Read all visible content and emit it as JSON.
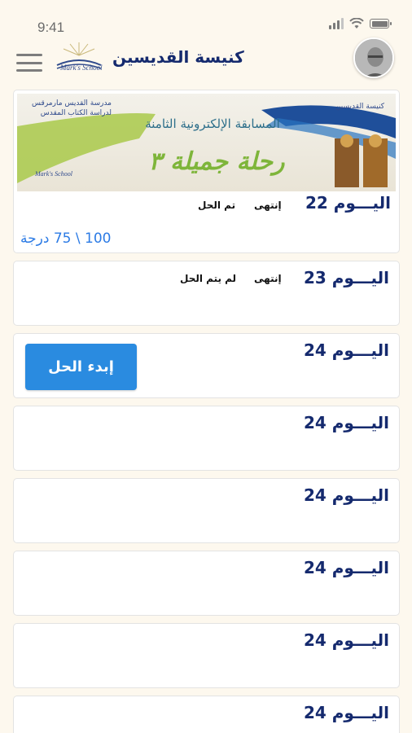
{
  "status_bar": {
    "time": "9:41"
  },
  "header": {
    "title": "كنيسة القديسين",
    "logo_text": "Mark's School",
    "menu_icon": "hamburger-menu-icon",
    "avatar": "user-avatar"
  },
  "banner": {
    "title_line1": "المسابقة الإلكترونية الثامنة",
    "title_line2": "رحلة جميلة ٣",
    "top_left_text": "مدرسة القديس مارمرقس لدراسة الكتاب المقدس",
    "top_right_text": "كنيسة القديسين",
    "logo_text": "Mark's School"
  },
  "days": [
    {
      "label": "اليـــوم 22",
      "status_label": "إنتهى",
      "status_value": "تم الحل",
      "score": "100 \\ 75 درجة"
    },
    {
      "label": "اليـــوم 23",
      "status_label": "إنتهى",
      "status_value": "لم يتم الحل"
    },
    {
      "label": "اليـــوم 24",
      "button": "إبدء الحل"
    },
    {
      "label": "اليـــوم 24"
    },
    {
      "label": "اليـــوم 24"
    },
    {
      "label": "اليـــوم 24"
    },
    {
      "label": "اليـــوم 24"
    },
    {
      "label": "اليـــوم 24"
    }
  ],
  "colors": {
    "background": "#fdf8ee",
    "primary": "#152a6e",
    "button": "#2a8be0",
    "score": "#2c7be5",
    "green": "#7eb53a"
  }
}
